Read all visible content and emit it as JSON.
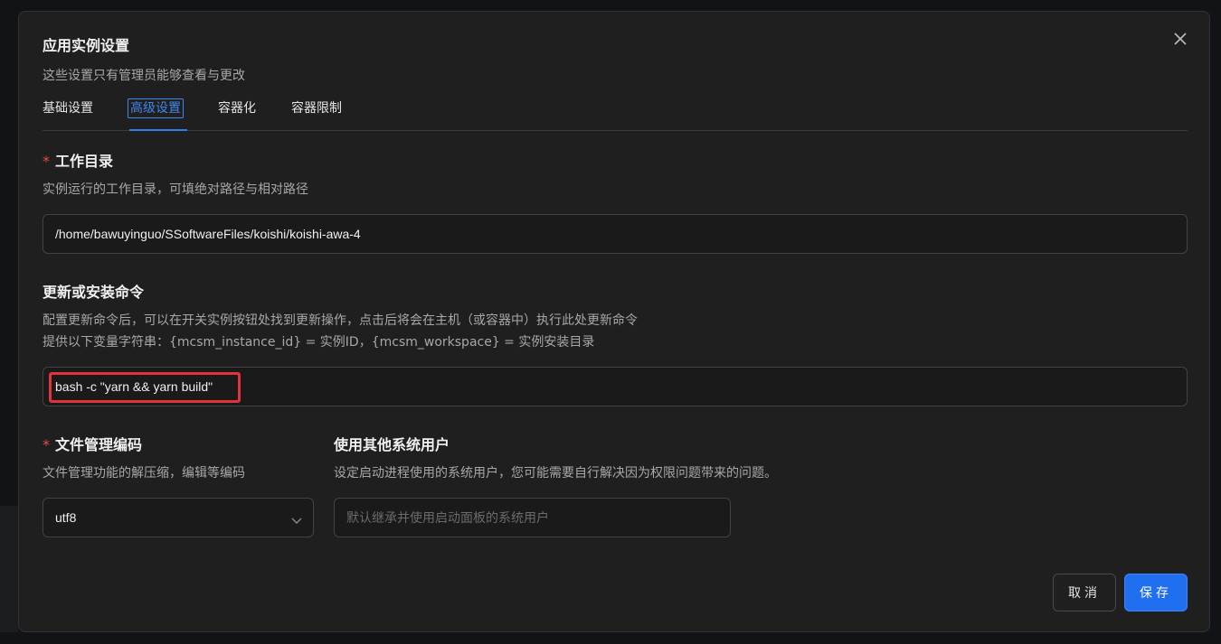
{
  "dialog": {
    "title": "应用实例设置",
    "subtitle": "这些设置只有管理员能够查看与更改"
  },
  "tabs": [
    {
      "label": "基础设置",
      "active": false
    },
    {
      "label": "高级设置",
      "active": true
    },
    {
      "label": "容器化",
      "active": false
    },
    {
      "label": "容器限制",
      "active": false
    }
  ],
  "work_dir": {
    "required_mark": "*",
    "label": "工作目录",
    "desc": "实例运行的工作目录，可填绝对路径与相对路径",
    "value": "/home/bawuyinguo/SSoftwareFiles/koishi/koishi-awa-4"
  },
  "update_cmd": {
    "label": "更新或安装命令",
    "desc_line1": "配置更新命令后，可以在开关实例按钮处找到更新操作，点击后将会在主机（或容器中）执行此处更新命令",
    "desc_line2": "提供以下变量字符串：{mcsm_instance_id} = 实例ID，{mcsm_workspace} = 实例安装目录",
    "value": "bash -c \"yarn && yarn build\""
  },
  "file_encoding": {
    "required_mark": "*",
    "label": "文件管理编码",
    "desc": "文件管理功能的解压缩，编辑等编码",
    "value": "utf8"
  },
  "system_user": {
    "label": "使用其他系统用户",
    "desc": "设定启动进程使用的系统用户，您可能需要自行解决因为权限问题带来的问题。",
    "placeholder": "默认继承并使用启动面板的系统用户"
  },
  "buttons": {
    "cancel": "取消",
    "save": "保存"
  },
  "colors": {
    "accent": "#1f6ff0",
    "highlight_box": "#e0333a",
    "required": "#e84749"
  },
  "icons": {
    "close": "close-icon",
    "dropdown": "chevron-down-icon"
  }
}
